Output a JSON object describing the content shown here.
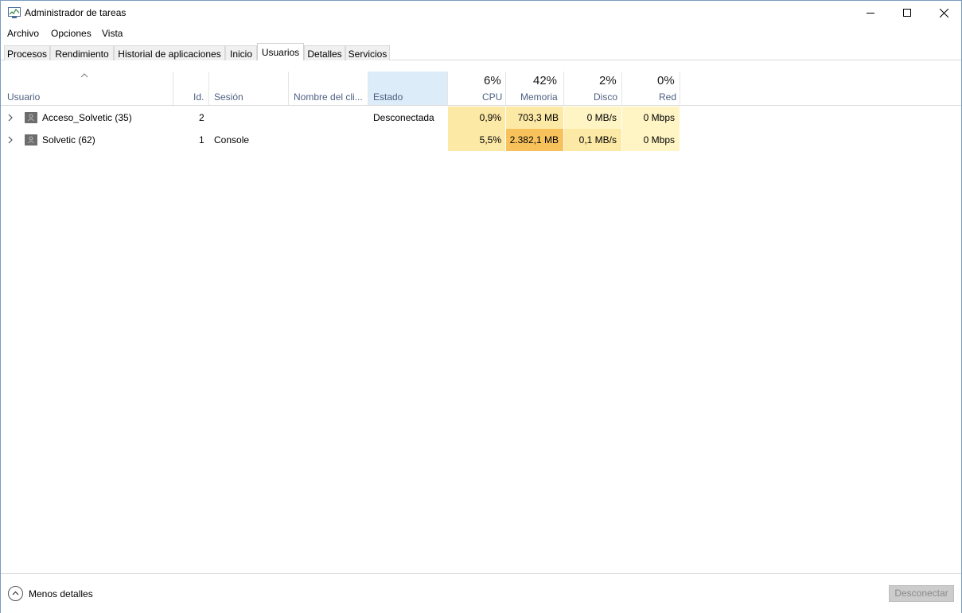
{
  "window": {
    "title": "Administrador de tareas"
  },
  "menu": {
    "items": [
      "Archivo",
      "Opciones",
      "Vista"
    ]
  },
  "tabs": [
    "Procesos",
    "Rendimiento",
    "Historial de aplicaciones",
    "Inicio",
    "Usuarios",
    "Detalles",
    "Servicios"
  ],
  "active_tab": "Usuarios",
  "columns": {
    "usuario": "Usuario",
    "id": "Id.",
    "sesion": "Sesión",
    "nombre_cliente": "Nombre del cli...",
    "estado": "Estado",
    "cpu": {
      "pct": "6%",
      "label": "CPU"
    },
    "memoria": {
      "pct": "42%",
      "label": "Memoria"
    },
    "disco": {
      "pct": "2%",
      "label": "Disco"
    },
    "red": {
      "pct": "0%",
      "label": "Red"
    }
  },
  "rows": [
    {
      "usuario": "Acceso_Solvetic (35)",
      "id": "2",
      "sesion": "",
      "nombre_cliente": "",
      "estado": "Desconectada",
      "cpu": "0,9%",
      "memoria": "703,3 MB",
      "disco": "0 MB/s",
      "red": "0 Mbps"
    },
    {
      "usuario": "Solvetic (62)",
      "id": "1",
      "sesion": "Console",
      "nombre_cliente": "",
      "estado": "",
      "cpu": "5,5%",
      "memoria": "2.382,1 MB",
      "disco": "0,1 MB/s",
      "red": "0 Mbps"
    }
  ],
  "heat_colors": {
    "light": "#fff4c4",
    "cpu": "#fce9a6",
    "mem_low": "#fce9a6",
    "mem_high": "#f7c25c",
    "disk_low": "#fff4c4",
    "disk_mid": "#fce9a6",
    "net": "#fff4c4",
    "estado_header": "#dcecf8"
  },
  "footer": {
    "less_details": "Menos detalles",
    "disconnect_button": "Desconectar"
  }
}
